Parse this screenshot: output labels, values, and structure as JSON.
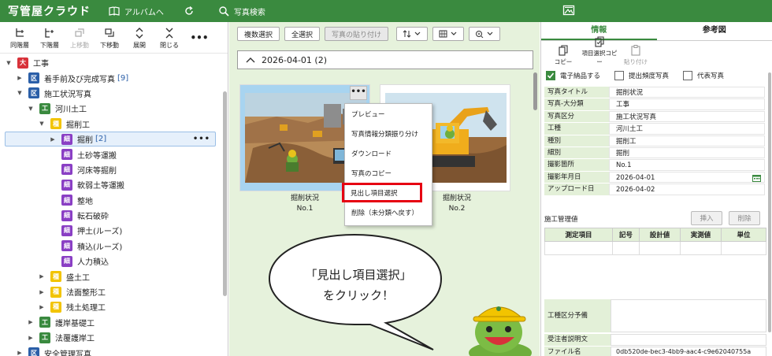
{
  "header": {
    "logo": "写管屋クラウド",
    "nav": [
      {
        "label": "アルバムへ",
        "icon": "album-icon"
      },
      {
        "label": "",
        "icon": "refresh-icon"
      },
      {
        "label": "写真検索",
        "icon": "search-icon"
      }
    ]
  },
  "left_toolbar": [
    {
      "label": "同階層",
      "icon": "same-level-add-icon",
      "disabled": false
    },
    {
      "label": "下階層",
      "icon": "sub-level-add-icon",
      "disabled": false
    },
    {
      "label": "上移動",
      "icon": "move-up-icon",
      "disabled": true
    },
    {
      "label": "下移動",
      "icon": "move-down-icon",
      "disabled": false
    },
    {
      "label": "展開",
      "icon": "expand-icon",
      "disabled": false
    },
    {
      "label": "閉じる",
      "icon": "collapse-icon",
      "disabled": false
    },
    {
      "label": "•••",
      "icon": "more-icon",
      "disabled": false
    }
  ],
  "tree": [
    {
      "indent": 0,
      "arrow": "▼",
      "badge": "大",
      "kind": "dai",
      "label": "工事",
      "count": ""
    },
    {
      "indent": 1,
      "arrow": "▶",
      "badge": "区",
      "kind": "ku",
      "label": "着手前及び完成写真",
      "count": "[9]"
    },
    {
      "indent": 1,
      "arrow": "▼",
      "badge": "区",
      "kind": "ku",
      "label": "施工状況写真",
      "count": ""
    },
    {
      "indent": 2,
      "arrow": "▼",
      "badge": "工",
      "kind": "ko",
      "label": "河川土工",
      "count": ""
    },
    {
      "indent": 3,
      "arrow": "▼",
      "badge": "種",
      "kind": "shu",
      "label": "掘削工",
      "count": ""
    },
    {
      "indent": 4,
      "arrow": "▶",
      "badge": "細",
      "kind": "sai",
      "label": "掘削",
      "count": "[2]",
      "selected": true
    },
    {
      "indent": 4,
      "arrow": "",
      "badge": "細",
      "kind": "sai",
      "label": "土砂等運搬",
      "count": ""
    },
    {
      "indent": 4,
      "arrow": "",
      "badge": "細",
      "kind": "sai",
      "label": "河床等掘削",
      "count": ""
    },
    {
      "indent": 4,
      "arrow": "",
      "badge": "細",
      "kind": "sai",
      "label": "軟弱土等運搬",
      "count": ""
    },
    {
      "indent": 4,
      "arrow": "",
      "badge": "細",
      "kind": "sai",
      "label": "整地",
      "count": ""
    },
    {
      "indent": 4,
      "arrow": "",
      "badge": "細",
      "kind": "sai",
      "label": "転石破砕",
      "count": ""
    },
    {
      "indent": 4,
      "arrow": "",
      "badge": "細",
      "kind": "sai",
      "label": "押土(ルーズ)",
      "count": ""
    },
    {
      "indent": 4,
      "arrow": "",
      "badge": "細",
      "kind": "sai",
      "label": "積込(ルーズ)",
      "count": ""
    },
    {
      "indent": 4,
      "arrow": "",
      "badge": "細",
      "kind": "sai",
      "label": "人力積込",
      "count": ""
    },
    {
      "indent": 3,
      "arrow": "▶",
      "badge": "種",
      "kind": "shu",
      "label": "盛土工",
      "count": ""
    },
    {
      "indent": 3,
      "arrow": "▶",
      "badge": "種",
      "kind": "shu",
      "label": "法面整形工",
      "count": ""
    },
    {
      "indent": 3,
      "arrow": "▶",
      "badge": "種",
      "kind": "shu",
      "label": "残土処理工",
      "count": ""
    },
    {
      "indent": 2,
      "arrow": "▶",
      "badge": "工",
      "kind": "ko",
      "label": "護岸基礎工",
      "count": ""
    },
    {
      "indent": 2,
      "arrow": "▶",
      "badge": "工",
      "kind": "ko",
      "label": "法覆護岸工",
      "count": ""
    },
    {
      "indent": 1,
      "arrow": "▶",
      "badge": "区",
      "kind": "ku",
      "label": "安全管理写真",
      "count": ""
    }
  ],
  "mid_toolbar": {
    "multi_select": "複数選択",
    "select_all": "全選択",
    "paste": "写真の貼り付け"
  },
  "date_group": "2026-04-01 (2)",
  "photos": [
    {
      "title": "掘削状況",
      "no": "No.1"
    },
    {
      "title": "掘削状況",
      "no": "No.2"
    }
  ],
  "context_menu": [
    "プレビュー",
    "写真情報分類振り分け",
    "ダウンロード",
    "写真のコピー",
    "見出し項目選択",
    "削除（未分類へ戻す）"
  ],
  "callout": {
    "line1": "「見出し項目選択」",
    "line2": "をクリック！"
  },
  "right_tabs": [
    "情報",
    "参考図"
  ],
  "right_toolbar": [
    {
      "label": "コピー",
      "icon": "copy-icon",
      "disabled": false
    },
    {
      "label": "項目選択コピー",
      "icon": "select-copy-icon",
      "disabled": false
    },
    {
      "label": "貼り付け",
      "icon": "paste-icon",
      "disabled": true
    }
  ],
  "checks": [
    {
      "label": "電子納品する",
      "checked": true
    },
    {
      "label": "提出頻度写真",
      "checked": false
    },
    {
      "label": "代表写真",
      "checked": false
    }
  ],
  "fields": [
    {
      "k": "写真タイトル",
      "v": "掘削状況"
    },
    {
      "k": "写真-大分類",
      "v": "工事"
    },
    {
      "k": "写真区分",
      "v": "施工状況写真"
    },
    {
      "k": "工種",
      "v": "河川土工"
    },
    {
      "k": "種別",
      "v": "掘削工"
    },
    {
      "k": "細別",
      "v": "掘削"
    },
    {
      "k": "撮影箇所",
      "v": "No.1"
    },
    {
      "k": "撮影年月日",
      "v": "2026-04-01"
    },
    {
      "k": "アップロード日",
      "v": "2026-04-02"
    }
  ],
  "construction": {
    "title": "施工管理値",
    "insert": "挿入",
    "delete": "削除",
    "columns": [
      "測定項目",
      "記号",
      "設計値",
      "実測値",
      "単位"
    ]
  },
  "bottom_fields": {
    "koshu_kubun": "工種区分予備",
    "juchusha": "受注者説明文",
    "filename_label": "ファイル名",
    "filename_value": "0db520de-bec3-4bb9-aac4-c9e62040755a"
  },
  "colors": {
    "brand_green": "#3a8a3f",
    "highlight_red": "#e60012",
    "panel_green": "#e6f2dc"
  }
}
